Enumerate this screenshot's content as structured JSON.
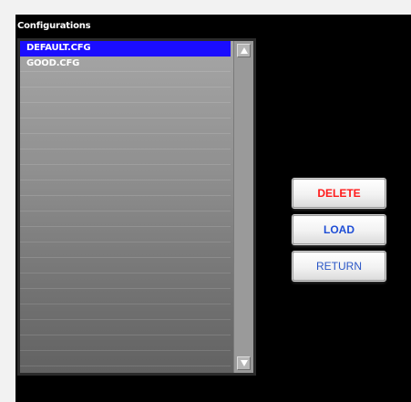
{
  "panel": {
    "title": "Configurations"
  },
  "configurations": {
    "items": [
      "DEFAULT.CFG",
      "GOOD.CFG",
      "",
      "",
      "",
      "",
      "",
      "",
      "",
      "",
      "",
      "",
      "",
      "",
      "",
      "",
      "",
      "",
      "",
      "",
      ""
    ],
    "selected": "DEFAULT.CFG"
  },
  "scrollbar": {
    "up_icon": "triangle-up-icon",
    "down_icon": "triangle-down-icon"
  },
  "buttons": {
    "delete": "DELETE",
    "load": "LOAD",
    "return": "RETURN"
  },
  "colors": {
    "background": "#000000",
    "selection": "#1a0dff",
    "delete_text": "#ff1a1a",
    "load_text": "#1f4ed6",
    "return_text": "#2a56c6"
  }
}
